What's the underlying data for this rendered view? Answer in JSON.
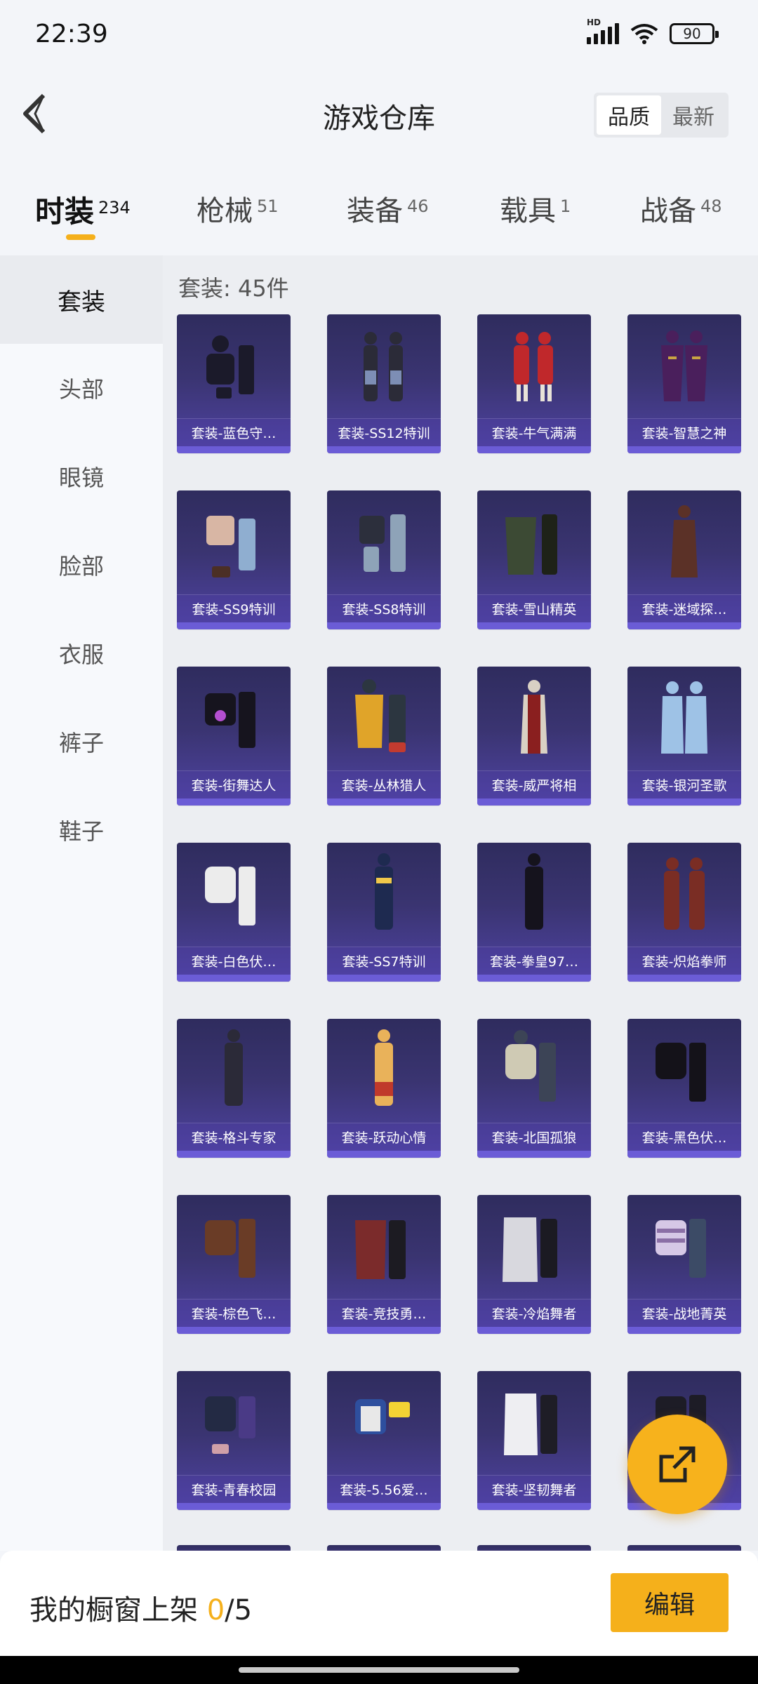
{
  "status_bar": {
    "time": "22:39",
    "battery": "90",
    "network": "HD"
  },
  "header": {
    "title": "游戏仓库",
    "sort_options": [
      "品质",
      "最新"
    ]
  },
  "tabs": [
    {
      "label": "时装",
      "count": "234"
    },
    {
      "label": "枪械",
      "count": "51"
    },
    {
      "label": "装备",
      "count": "46"
    },
    {
      "label": "载具",
      "count": "1"
    },
    {
      "label": "战备",
      "count": "48"
    }
  ],
  "sidebar": {
    "items": [
      "套装",
      "头部",
      "眼镜",
      "脸部",
      "衣服",
      "裤子",
      "鞋子"
    ]
  },
  "content": {
    "section_count": "套装: 45件",
    "items": [
      "套装-蓝色守…",
      "套装-SS12特训",
      "套装-牛气满满",
      "套装-智慧之神",
      "套装-SS9特训",
      "套装-SS8特训",
      "套装-雪山精英",
      "套装-迷域探…",
      "套装-街舞达人",
      "套装-丛林猎人",
      "套装-威严将相",
      "套装-银河圣歌",
      "套装-白色伏…",
      "套装-SS7特训",
      "套装-拳皇97…",
      "套装-炽焰拳师",
      "套装-格斗专家",
      "套装-跃动心情",
      "套装-北国孤狼",
      "套装-黑色伏…",
      "套装-棕色飞…",
      "套装-竞技勇…",
      "套装-冷焰舞者",
      "套装-战地菁英",
      "套装-青春校园",
      "套装-5.56爱…",
      "套装-坚韧舞者",
      "…"
    ]
  },
  "bottom_bar": {
    "label": "我的橱窗上架 ",
    "current": "0",
    "separator_total": "/5",
    "edit": "编辑"
  },
  "colors": {
    "accent": "#f5b01b",
    "card_top": "#2f2c5e",
    "card_bottom": "#4f43a3"
  }
}
